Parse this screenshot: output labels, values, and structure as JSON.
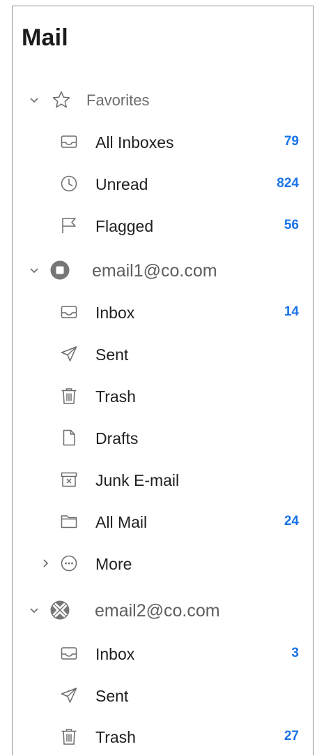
{
  "app": {
    "title": "Mail"
  },
  "colors": {
    "accent": "#1a73e8",
    "border": "#8a8f98",
    "icon": "#6b6b6b"
  },
  "favorites": {
    "label": "Favorites",
    "icon": "star-icon",
    "expanded": true,
    "items": [
      {
        "label": "All Inboxes",
        "count": "79",
        "icon": "inbox-tray-icon"
      },
      {
        "label": "Unread",
        "count": "824",
        "icon": "clock-icon"
      },
      {
        "label": "Flagged",
        "count": "56",
        "icon": "flag-icon"
      }
    ]
  },
  "accounts": [
    {
      "email": "email1@co.com",
      "expanded": true,
      "items": [
        {
          "label": "Inbox",
          "count": "14",
          "icon": "inbox-tray-icon"
        },
        {
          "label": "Sent",
          "count": "",
          "icon": "paper-plane-icon"
        },
        {
          "label": "Trash",
          "count": "",
          "icon": "trash-icon"
        },
        {
          "label": "Drafts",
          "count": "",
          "icon": "document-icon"
        },
        {
          "label": "Junk E-mail",
          "count": "",
          "icon": "junk-icon"
        },
        {
          "label": "All Mail",
          "count": "24",
          "icon": "folder-icon"
        },
        {
          "label": "More",
          "count": "",
          "icon": "more-icon",
          "collapsed": true
        }
      ]
    },
    {
      "email": "email2@co.com",
      "expanded": true,
      "items": [
        {
          "label": "Inbox",
          "count": "3",
          "icon": "inbox-tray-icon"
        },
        {
          "label": "Sent",
          "count": "",
          "icon": "paper-plane-icon"
        },
        {
          "label": "Trash",
          "count": "27",
          "icon": "trash-icon"
        }
      ]
    }
  ]
}
